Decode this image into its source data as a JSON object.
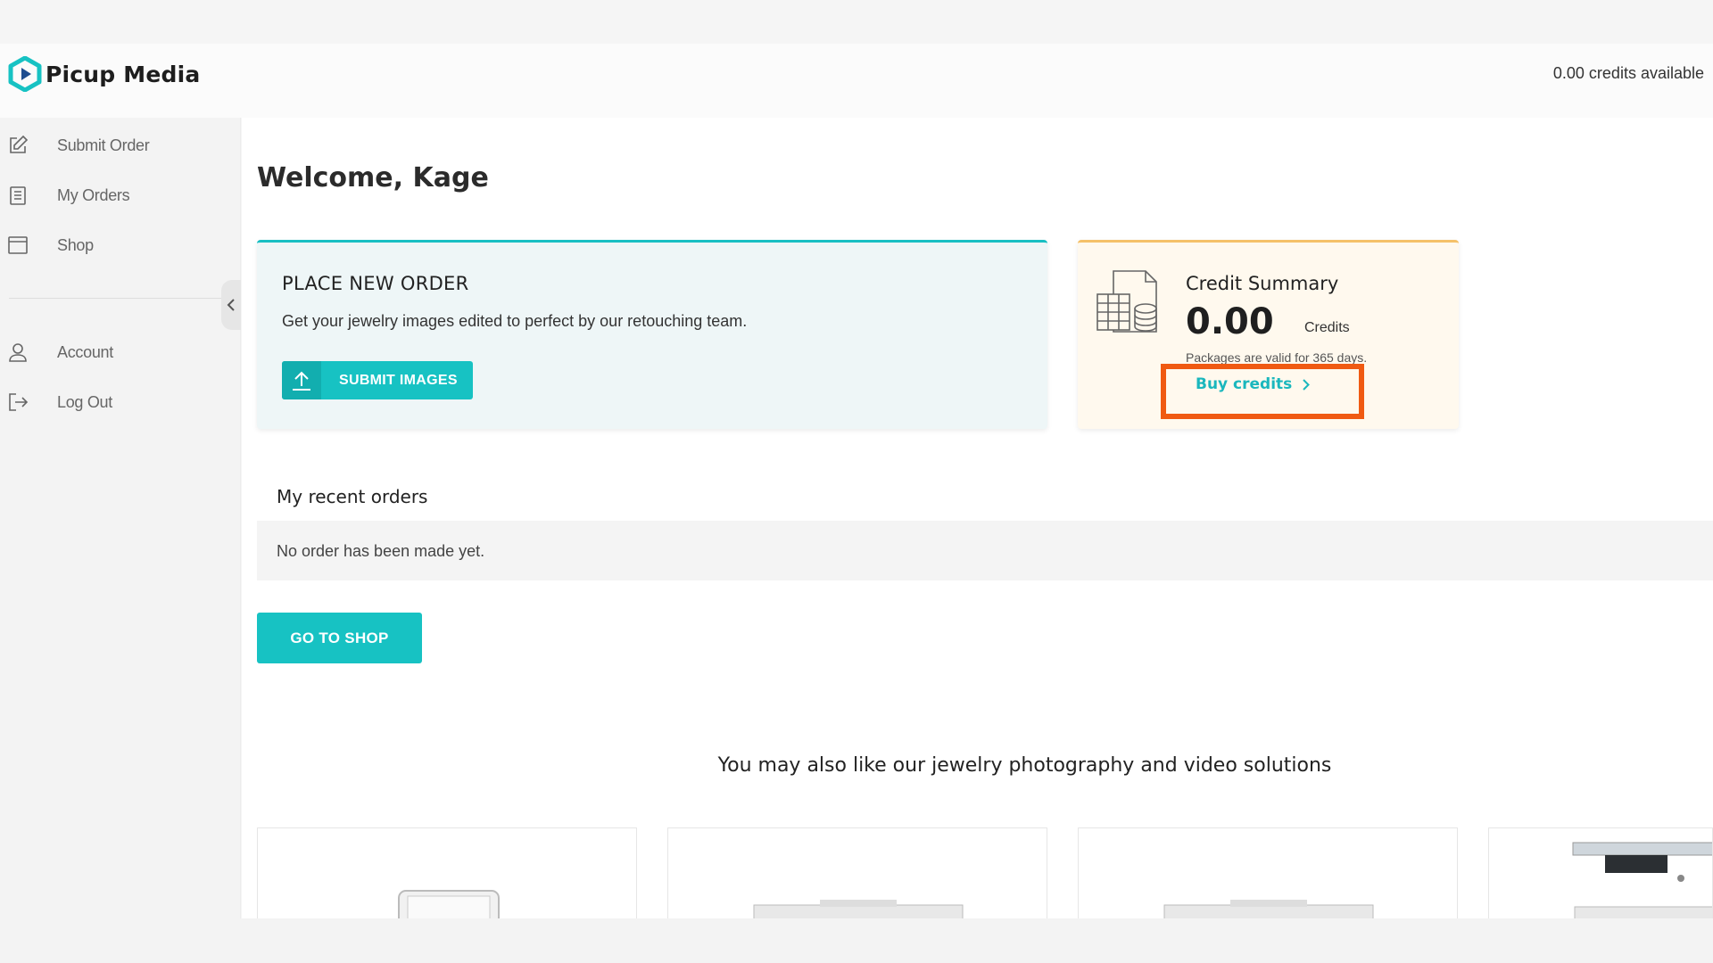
{
  "brand": {
    "name": "Picup Media",
    "color": "#17c2c3"
  },
  "header": {
    "credits_available": "0.00 credits available"
  },
  "sidebar": {
    "items": [
      {
        "label": "Submit Order",
        "icon": "edit-icon"
      },
      {
        "label": "My Orders",
        "icon": "clipboard-icon"
      },
      {
        "label": "Shop",
        "icon": "shop-icon"
      },
      {
        "label": "Account",
        "icon": "user-icon"
      },
      {
        "label": "Log Out",
        "icon": "logout-icon"
      }
    ]
  },
  "main": {
    "welcome": "Welcome, Kage",
    "order_card": {
      "title": "PLACE NEW ORDER",
      "description": "Get your jewelry images edited to perfect by our retouching team.",
      "button": "SUBMIT IMAGES"
    },
    "credit_card": {
      "title": "Credit Summary",
      "value": "0.00",
      "unit": "Credits",
      "note": "Packages are valid for 365 days.",
      "buy_label": "Buy credits"
    },
    "recent_orders": {
      "title": "My recent orders",
      "empty_text": "No order has been made yet."
    },
    "shop_button": "GO TO SHOP",
    "also_like": "You may also like our jewelry photography and video solutions"
  },
  "colors": {
    "accent": "#17c2c3",
    "highlight": "#f05a12",
    "credit_border": "#f5c169"
  }
}
